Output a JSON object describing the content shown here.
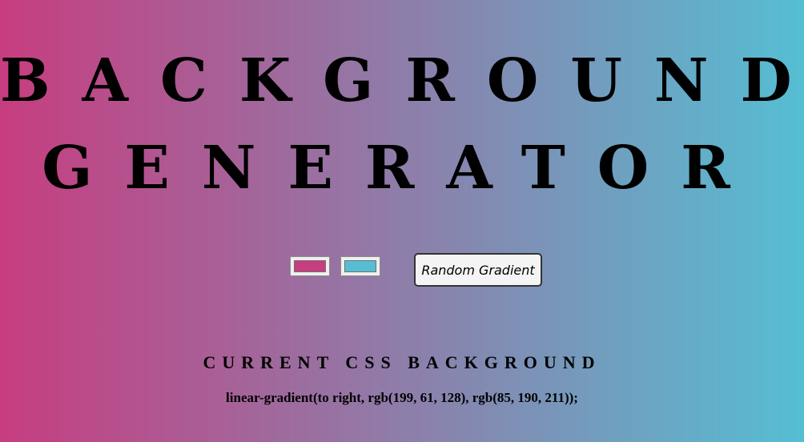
{
  "header": {
    "title_line1": "BACKGROUND",
    "title_line2": "GENERATOR"
  },
  "controls": {
    "color1": "#c73d80",
    "color2": "#55bed3",
    "random_button_label": "Random Gradient"
  },
  "output": {
    "heading": "CURRENT CSS BACKGROUND",
    "css_text": "linear-gradient(to right, rgb(199, 61, 128), rgb(85, 190, 211));"
  },
  "colors": {
    "gradient_start": "#c73d80",
    "gradient_end": "#55bed3"
  }
}
